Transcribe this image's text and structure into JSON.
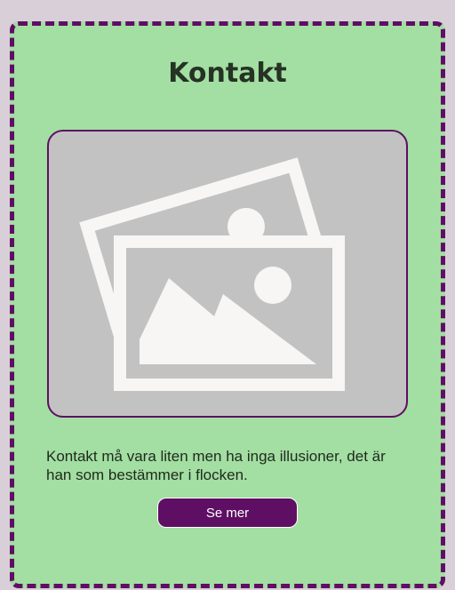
{
  "card": {
    "title": "Kontakt",
    "image_icon": "image-placeholder-icon",
    "description": "Kontakt må vara liten men ha inga illusioner, det är han som bestämmer i flocken.",
    "button_label": "Se mer"
  },
  "colors": {
    "page_background": "#d9cfd9",
    "card_background": "#a3dea2",
    "accent": "#5e0f63",
    "image_background": "#c3c2c3",
    "icon_color": "#f7f6f4"
  }
}
